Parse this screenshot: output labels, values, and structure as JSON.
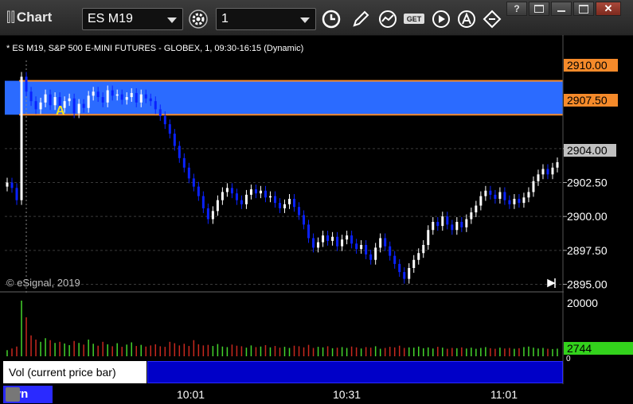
{
  "window": {
    "title": "Chart",
    "symbol": "ES M19",
    "interval": "1"
  },
  "chart": {
    "subtitle": "* ES M19, S&P 500 E-MINI FUTURES - GLOBEX, 1, 09:30-16:15 (Dynamic)",
    "copyright": "© eSignal, 2019",
    "marker": "A",
    "volume_panel_label": "Vol (current price bar)",
    "volume_close": "×",
    "status_mode": "Dyn",
    "colors": {
      "up": "#ffffff",
      "down": "#0a22ff",
      "zone": "#2b6bff",
      "level": "#f58a2a",
      "vol_up": "#44d42c",
      "vol_down": "#c8281e"
    }
  },
  "chart_data": {
    "type": "candlestick",
    "price_axis": {
      "range": [
        2894.5,
        2911.5
      ],
      "ticks": [
        "2905.00",
        "2902.50",
        "2900.00",
        "2897.50",
        "2895.00"
      ]
    },
    "levels": [
      "2910.00",
      "2907.50"
    ],
    "zone": [
      2907.5,
      2910.0
    ],
    "last_price": "2904.00",
    "volume_axis": {
      "max": "20000",
      "min": "0",
      "current": "2744"
    },
    "time_ticks": [
      "10:01",
      "10:31",
      "11:01"
    ],
    "closes": [
      2902.5,
      2902.1,
      2901.2,
      2910.3,
      2909.2,
      2908.5,
      2907.9,
      2908.4,
      2909.0,
      2908.2,
      2908.8,
      2908.0,
      2908.5,
      2908.7,
      2907.6,
      2908.3,
      2908.0,
      2908.9,
      2909.2,
      2908.8,
      2908.4,
      2909.3,
      2908.9,
      2909.0,
      2908.6,
      2908.8,
      2909.1,
      2908.4,
      2909.0,
      2908.7,
      2908.5,
      2907.9,
      2907.4,
      2906.8,
      2906.1,
      2905.2,
      2904.3,
      2903.6,
      2902.8,
      2902.2,
      2901.5,
      2900.6,
      2899.8,
      2900.4,
      2901.2,
      2901.8,
      2902.1,
      2901.7,
      2901.2,
      2900.9,
      2901.6,
      2902.0,
      2901.7,
      2901.9,
      2901.4,
      2901.5,
      2901.0,
      2900.6,
      2900.9,
      2901.3,
      2900.7,
      2900.1,
      2899.4,
      2898.4,
      2897.7,
      2898.1,
      2898.6,
      2898.2,
      2898.5,
      2897.8,
      2898.3,
      2898.6,
      2898.0,
      2897.6,
      2897.9,
      2897.2,
      2896.8,
      2897.7,
      2898.4,
      2897.8,
      2897.1,
      2896.5,
      2895.9,
      2895.4,
      2896.2,
      2896.8,
      2897.3,
      2897.9,
      2899.0,
      2899.6,
      2899.3,
      2900.0,
      2899.4,
      2899.0,
      2899.6,
      2899.2,
      2899.8,
      2900.3,
      2900.8,
      2901.5,
      2901.9,
      2901.6,
      2901.3,
      2901.8,
      2901.2,
      2900.9,
      2901.3,
      2901.0,
      2901.4,
      2901.8,
      2902.6,
      2903.1,
      2903.5,
      2903.1,
      2903.6,
      2904.0
    ],
    "volumes": [
      2200,
      2800,
      3500,
      20000,
      14000,
      7500,
      6000,
      5200,
      6500,
      5800,
      4800,
      5200,
      4600,
      4000,
      5500,
      4800,
      4200,
      6000,
      4500,
      3800,
      5200,
      4300,
      3600,
      4700,
      3400,
      4200,
      5000,
      3700,
      4100,
      3500,
      3900,
      4300,
      3600,
      3400,
      5200,
      4700,
      3900,
      4500,
      3700,
      5800,
      4300,
      3900,
      4100,
      3700,
      4400,
      3500,
      3300,
      4200,
      3800,
      3600,
      3100,
      3900,
      3300,
      3500,
      4000,
      3200,
      3700,
      3100,
      3400,
      3000,
      3800,
      3600,
      3200,
      4100,
      3000,
      3400,
      3200,
      3600,
      2900,
      3100,
      3300,
      3000,
      3500,
      3200,
      2800,
      3300,
      3100,
      3600,
      2700,
      3000,
      3400,
      3200,
      3800,
      3000,
      3200,
      3100,
      3500,
      2900,
      3200,
      2800,
      3400,
      3100,
      2700,
      3000,
      2900,
      3200,
      2800,
      3100,
      2700,
      3000,
      3300,
      2900,
      2700,
      3100,
      2800,
      3000,
      2700,
      2900,
      3300,
      3500,
      3100,
      2800,
      3000,
      2700,
      2600,
      2744
    ]
  }
}
